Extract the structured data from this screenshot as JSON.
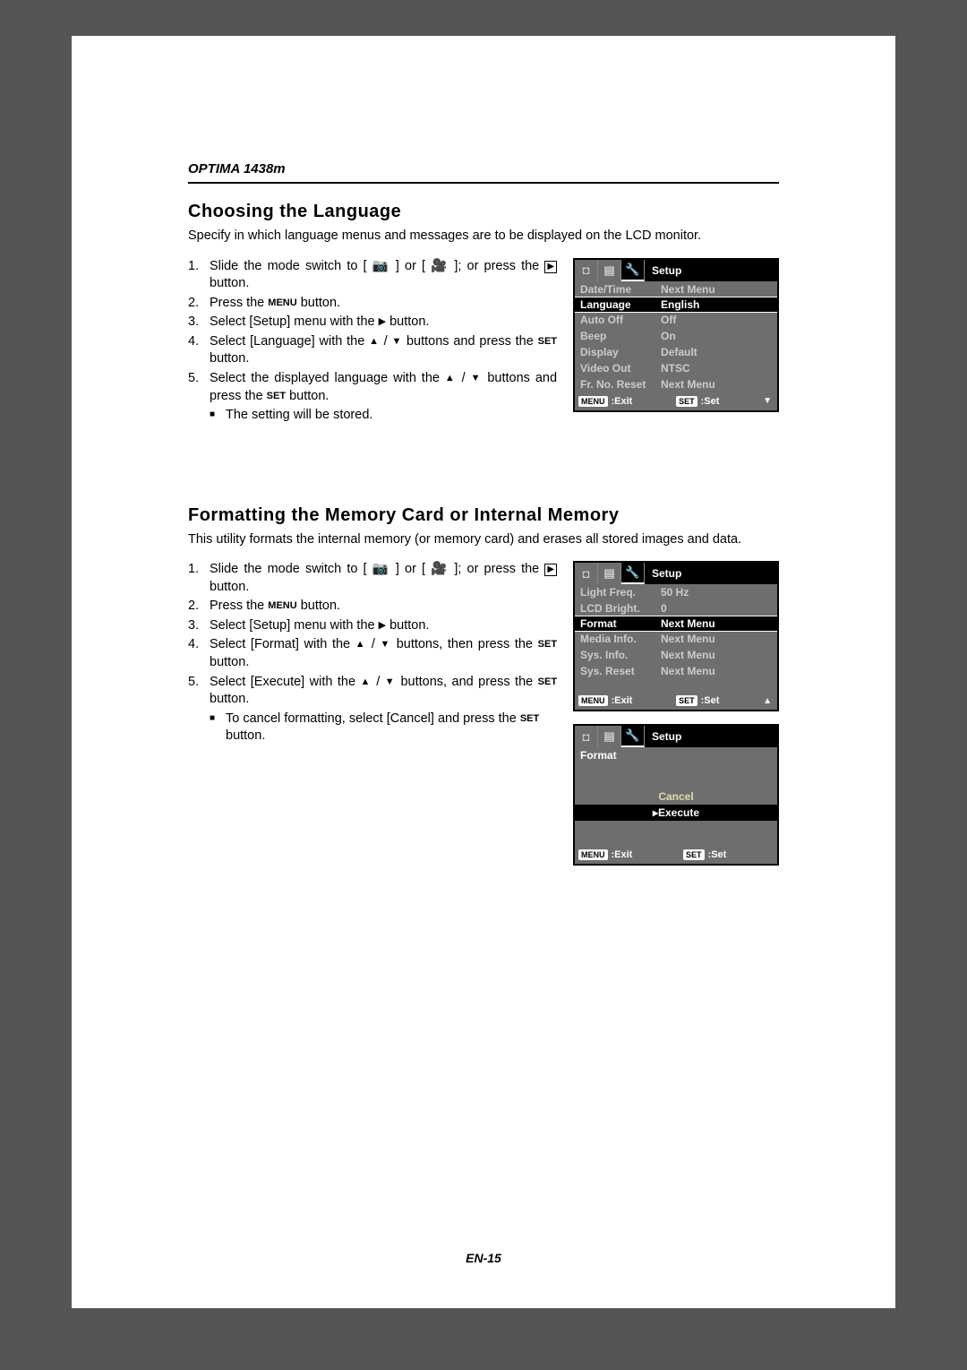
{
  "header": {
    "model": "OPTIMA 1438m"
  },
  "section1": {
    "title": "Choosing the Language",
    "intro": "Specify in which language menus and messages are to be displayed on the LCD monitor.",
    "steps": {
      "s1a": "Slide the mode switch to [",
      "s1b": "] or [",
      "s1c": "]; or press the ",
      "s1d": " button.",
      "s2a": "Press the ",
      "s2b": " button.",
      "s3a": "Select [Setup] menu with the ",
      "s3b": " button.",
      "s4a": "Select [Language] with the ",
      "s4b": " / ",
      "s4c": " buttons and press the ",
      "s4d": " button.",
      "s5a": "Select the displayed language with the ",
      "s5b": " / ",
      "s5c": " buttons and press the ",
      "s5d": " button.",
      "bullet": "The setting will be stored."
    },
    "btn_menu": "MENU",
    "btn_set": "SET",
    "lcd": {
      "title": "Setup",
      "rows": [
        {
          "k": "Date/Time",
          "v": "Next Menu",
          "hl": false
        },
        {
          "k": "Language",
          "v": "English",
          "hl": true
        },
        {
          "k": "Auto Off",
          "v": "Off",
          "hl": false
        },
        {
          "k": "Beep",
          "v": "On",
          "hl": false
        },
        {
          "k": "Display",
          "v": "Default",
          "hl": false
        },
        {
          "k": "Video Out",
          "v": "NTSC",
          "hl": false
        },
        {
          "k": "Fr. No. Reset",
          "v": "Next Menu",
          "hl": false
        }
      ],
      "foot_menu": "MENU",
      "foot_exit": ":Exit",
      "foot_set": "SET",
      "foot_setlbl": ":Set",
      "arrow": "down"
    }
  },
  "section2": {
    "title": "Formatting the Memory Card or Internal Memory",
    "intro": "This utility formats the internal memory (or memory card) and erases all stored images and data.",
    "steps": {
      "s1a": "Slide the mode switch to [",
      "s1b": "] or [",
      "s1c": "]; or press the ",
      "s1d": " button.",
      "s2a": "Press the ",
      "s2b": " button.",
      "s3a": "Select [Setup] menu with the ",
      "s3b": " button.",
      "s4a": "Select [Format] with the ",
      "s4b": " / ",
      "s4c": " buttons, then press the ",
      "s4d": " button.",
      "s5a": "Select [Execute] with the ",
      "s5b": " / ",
      "s5c": " buttons, and press the ",
      "s5d": " button.",
      "bullet_a": "To cancel formatting, select [Cancel] and press the ",
      "bullet_b": " button."
    },
    "btn_menu": "MENU",
    "btn_set": "SET",
    "lcd2a": {
      "title": "Setup",
      "rows": [
        {
          "k": "Light Freq.",
          "v": "50 Hz",
          "hl": false
        },
        {
          "k": "LCD Bright.",
          "v": "0",
          "hl": false
        },
        {
          "k": "Format",
          "v": "Next Menu",
          "hl": true
        },
        {
          "k": "Media Info.",
          "v": "Next Menu",
          "hl": false
        },
        {
          "k": "Sys. Info.",
          "v": "Next Menu",
          "hl": false
        },
        {
          "k": "Sys. Reset",
          "v": "Next Menu",
          "hl": false
        }
      ],
      "foot_menu": "MENU",
      "foot_exit": ":Exit",
      "foot_set": "SET",
      "foot_setlbl": ":Set",
      "arrow": "up"
    },
    "lcd2b": {
      "title": "Setup",
      "heading": "Format",
      "cancel": "Cancel",
      "execute": "Execute",
      "marker": "▸",
      "foot_menu": "MENU",
      "foot_exit": ":Exit",
      "foot_set": "SET",
      "foot_setlbl": ":Set"
    }
  },
  "footer": {
    "page": "EN-15"
  }
}
